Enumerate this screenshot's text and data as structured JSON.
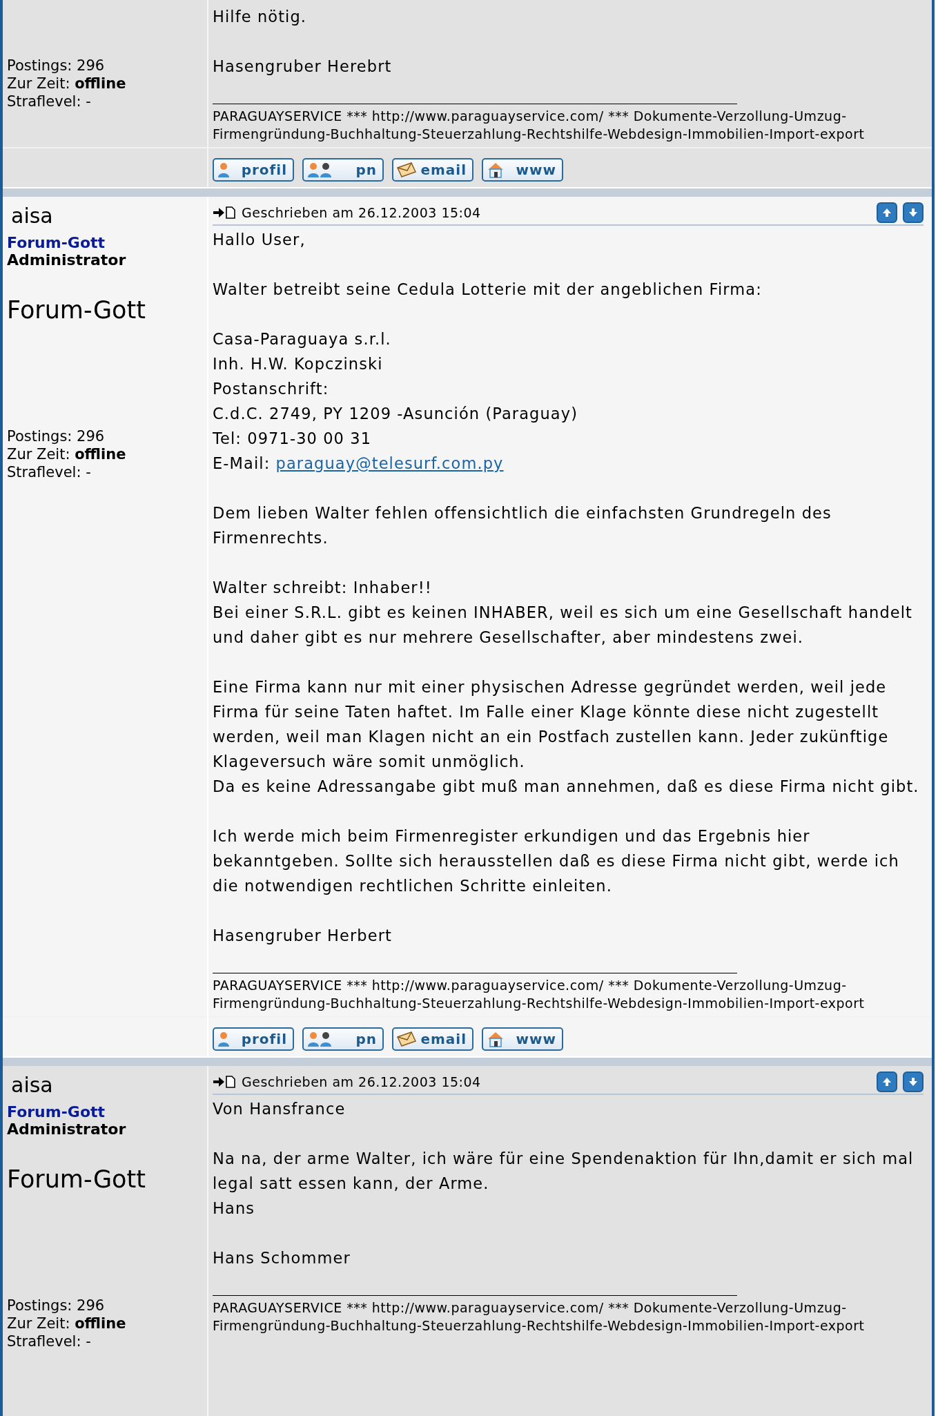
{
  "posts": [
    {
      "stats": {
        "postings_label": "Postings:",
        "postings": "296",
        "status_label": "Zur Zeit:",
        "status": "offline",
        "penalty_label": "Straflevel:",
        "penalty": "-"
      },
      "body": [
        [
          "Hilfe nötig."
        ],
        [
          "Hasengruber Herebrt"
        ]
      ],
      "signature": "PARAGUAYSERVICE *** http://www.paraguayservice.com/ *** Dokumente-Verzollung-Umzug-Firmengründung-Buchhaltung-Steuerzahlung-Rechtshilfe-Webdesign-Immobilien-Import-export",
      "buttons": [
        {
          "kind": "profile",
          "label": "profil"
        },
        {
          "kind": "message",
          "label": "pn"
        },
        {
          "kind": "email",
          "label": "email"
        },
        {
          "kind": "www",
          "label": "www"
        }
      ]
    },
    {
      "author": "aisa",
      "rank": "Forum-Gott",
      "role": "Administrator",
      "rank_title": "Forum-Gott",
      "stats": {
        "postings_label": "Postings:",
        "postings": "296",
        "status_label": "Zur Zeit:",
        "status": "offline",
        "penalty_label": "Straflevel:",
        "penalty": "-"
      },
      "posted": "Geschrieben am 26.12.2003 15:04",
      "body": [
        [
          "Hallo User,"
        ],
        [
          "Walter betreibt seine Cedula Lotterie mit der angeblichen Firma:"
        ],
        [
          "Casa-Paraguaya s.r.l.",
          "Inh. H.W. Kopczinski",
          "Postanschrift:",
          "C.d.C. 2749, PY 1209 -Asunción (Paraguay)",
          "Tel: 0971-30 00 31",
          {
            "text": "E-Mail: ",
            "link": "paraguay@telesurf.com.py"
          }
        ],
        [
          "Dem lieben Walter fehlen offensichtlich die einfachsten Grundregeln des Firmenrechts."
        ],
        [
          "Walter schreibt: Inhaber!!",
          "Bei einer S.R.L. gibt es keinen INHABER, weil es sich um eine Gesellschaft handelt und daher gibt es nur mehrere Gesellschafter, aber mindestens zwei."
        ],
        [
          "Eine Firma kann nur mit einer physischen Adresse gegründet werden, weil jede Firma für seine Taten haftet. Im Falle einer Klage könnte diese nicht zugestellt werden, weil man Klagen nicht an ein Postfach zustellen kann. Jeder zukünftige Klageversuch wäre somit unmöglich.",
          "Da es keine Adressangabe gibt muß man annehmen, daß es diese Firma nicht gibt."
        ],
        [
          "Ich werde mich beim Firmenregister erkundigen und das Ergebnis hier bekanntgeben. Sollte sich herausstellen daß es diese Firma nicht gibt, werde ich die notwendigen rechtlichen Schritte einleiten."
        ],
        [
          "Hasengruber Herbert"
        ]
      ],
      "signature": "PARAGUAYSERVICE *** http://www.paraguayservice.com/ *** Dokumente-Verzollung-Umzug-Firmengründung-Buchhaltung-Steuerzahlung-Rechtshilfe-Webdesign-Immobilien-Import-export",
      "buttons": [
        {
          "kind": "profile",
          "label": "profil"
        },
        {
          "kind": "message",
          "label": "pn"
        },
        {
          "kind": "email",
          "label": "email"
        },
        {
          "kind": "www",
          "label": "www"
        }
      ]
    },
    {
      "author": "aisa",
      "rank": "Forum-Gott",
      "role": "Administrator",
      "rank_title": "Forum-Gott",
      "stats": {
        "postings_label": "Postings:",
        "postings": "296",
        "status_label": "Zur Zeit:",
        "status": "offline",
        "penalty_label": "Straflevel:",
        "penalty": "-"
      },
      "posted": "Geschrieben am 26.12.2003 15:04",
      "body": [
        [
          "Von Hansfrance"
        ],
        [
          "Na na, der arme Walter, ich wäre für eine Spendenaktion für Ihn,damit er sich mal legal satt essen kann, der Arme.",
          "Hans"
        ],
        [
          "Hans Schommer"
        ]
      ],
      "signature": "PARAGUAYSERVICE *** http://www.paraguayservice.com/ *** Dokumente-Verzollung-Umzug-Firmengründung-Buchhaltung-Steuerzahlung-Rechtshilfe-Webdesign-Immobilien-Import-export"
    }
  ]
}
